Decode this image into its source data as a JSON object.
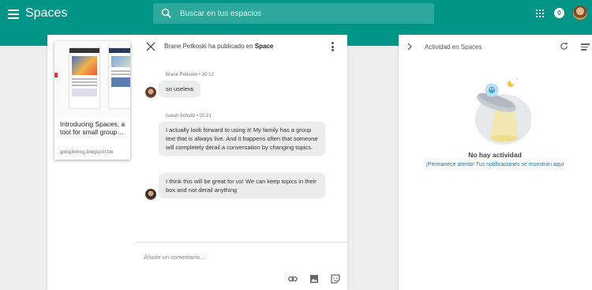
{
  "app": {
    "title": "Spaces",
    "search_placeholder": "Buscar en tus espacios",
    "notification_badge": "0"
  },
  "post": {
    "author": "Brane Petkoski",
    "header_middle": "ha publicado en",
    "space_name": "Space",
    "link": {
      "title": "Introducing Spaces, a tool for small group…",
      "domain": "googleblog.blogspot.be"
    },
    "messages": [
      {
        "author": "Brane Petkoski • 20:12",
        "text": "so useless"
      },
      {
        "author": "Isaiah Schultz • 20:21",
        "text": "I actually look forward to using it! My family has a group text that is always live. And it happens often that someone will completely derail a conversation by changing topics."
      },
      {
        "author": "",
        "text": "I think this will be great for us! We can keep topics in their box and not derail anything"
      }
    ],
    "comment_placeholder": "Añade un comentario..."
  },
  "activity": {
    "title": "Actividad en Spaces",
    "empty_title": "No hay actividad",
    "empty_subtitle": "¡Permanece atento! Tus notificaciones se muestran aquí"
  },
  "colors": {
    "appbar": "#009587",
    "background": "#eeeeee",
    "bubble": "#ebecee",
    "link_text": "#1a73a8"
  },
  "icons": [
    "menu-icon",
    "search-icon",
    "apps-icon",
    "notifications-icon",
    "close-icon",
    "more-vert-icon",
    "link-icon",
    "image-icon",
    "sticker-icon",
    "chevron-right-icon",
    "refresh-icon",
    "filter-icon",
    "ufo-illustration"
  ]
}
